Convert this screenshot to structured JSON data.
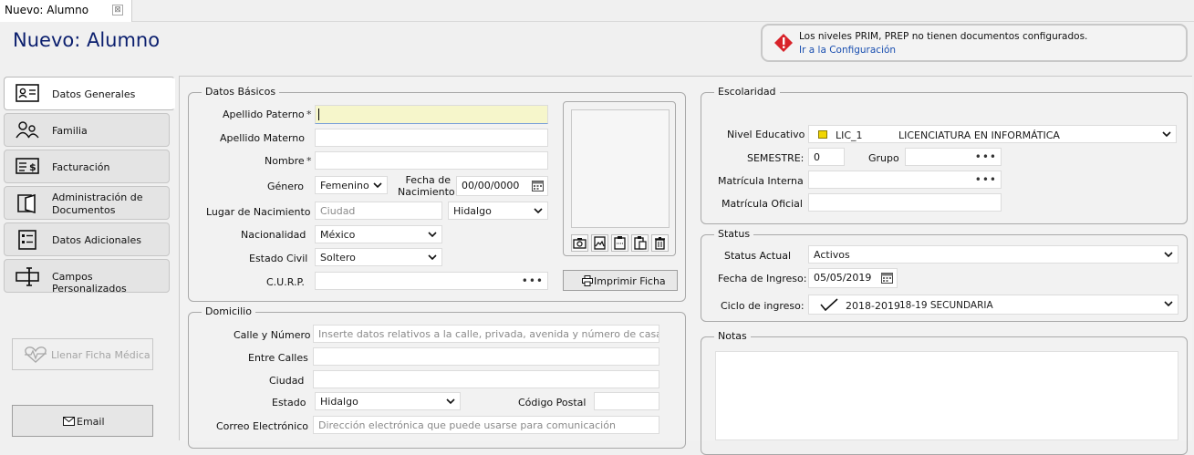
{
  "tab": {
    "label": "Nuevo: Alumno",
    "close": "⊠"
  },
  "page": {
    "title": "Nuevo: Alumno"
  },
  "alert": {
    "message": "Los niveles PRIM, PREP no tienen documentos configurados.",
    "link": "Ir a la Configuración",
    "color": "#d8232a"
  },
  "nav": {
    "items": [
      {
        "label": "Datos Generales",
        "icon": "id-card-icon",
        "active": true
      },
      {
        "label": "Familia",
        "icon": "people-icon"
      },
      {
        "label": "Facturación",
        "icon": "invoice-icon"
      },
      {
        "label": "Administración de",
        "label2": "Documentos",
        "icon": "folder-doc-icon"
      },
      {
        "label": "Datos Adicionales",
        "icon": "list-doc-icon"
      },
      {
        "label": "Campos Personalizados",
        "icon": "custom-field-icon"
      }
    ],
    "medical_button": "Llenar Ficha Médica",
    "email_button": "Email"
  },
  "basicos": {
    "title": "Datos Básicos",
    "apellido_paterno": {
      "label": "Apellido Paterno",
      "required": "*",
      "value": ""
    },
    "apellido_materno": {
      "label": "Apellido Materno",
      "value": ""
    },
    "nombre": {
      "label": "Nombre",
      "required": "*",
      "value": ""
    },
    "genero": {
      "label": "Género",
      "value": "Femenino"
    },
    "fecha_nacimiento": {
      "label1": "Fecha de",
      "label2": "Nacimiento",
      "value": "00/00/0000"
    },
    "lugar_nacimiento": {
      "label": "Lugar de Nacimiento",
      "placeholder": "Ciudad",
      "estado": "Hidalgo"
    },
    "nacionalidad": {
      "label": "Nacionalidad",
      "value": "México"
    },
    "estado_civil": {
      "label": "Estado Civil",
      "value": "Soltero"
    },
    "curp": {
      "label": "C.U.R.P.",
      "value": ""
    },
    "print_button": "Imprimir Ficha"
  },
  "domicilio": {
    "title": "Domicilio",
    "calle": {
      "label": "Calle y Número",
      "placeholder": "Inserte datos relativos a la calle, privada, avenida y número de casa"
    },
    "entre_calles": {
      "label": "Entre Calles",
      "value": ""
    },
    "ciudad": {
      "label": "Ciudad",
      "value": ""
    },
    "estado": {
      "label": "Estado",
      "value": "Hidalgo"
    },
    "codigo_postal": {
      "label": "Código Postal",
      "value": ""
    },
    "correo": {
      "label": "Correo Electrónico",
      "placeholder": "Dirección electrónica que puede usarse para comunicación"
    }
  },
  "escolaridad": {
    "title": "Escolaridad",
    "nivel": {
      "label": "Nivel Educativo",
      "code": "LIC_1",
      "name": "LICENCIATURA EN INFORMÁTICA"
    },
    "semestre": {
      "label": "SEMESTRE:",
      "value": "0"
    },
    "grupo": {
      "label": "Grupo",
      "value": ""
    },
    "matricula_interna": {
      "label": "Matrícula Interna",
      "value": ""
    },
    "matricula_oficial": {
      "label": "Matrícula Oficial",
      "value": ""
    }
  },
  "status": {
    "title": "Status",
    "actual": {
      "label": "Status Actual",
      "value": "Activos"
    },
    "fecha_ingreso": {
      "label": "Fecha de Ingreso:",
      "value": "05/05/2019"
    },
    "ciclo": {
      "label": "Ciclo de ingreso:",
      "code": "2018-2019",
      "name": "18-19 SECUNDARIA"
    }
  },
  "notas": {
    "title": "Notas",
    "value": ""
  }
}
